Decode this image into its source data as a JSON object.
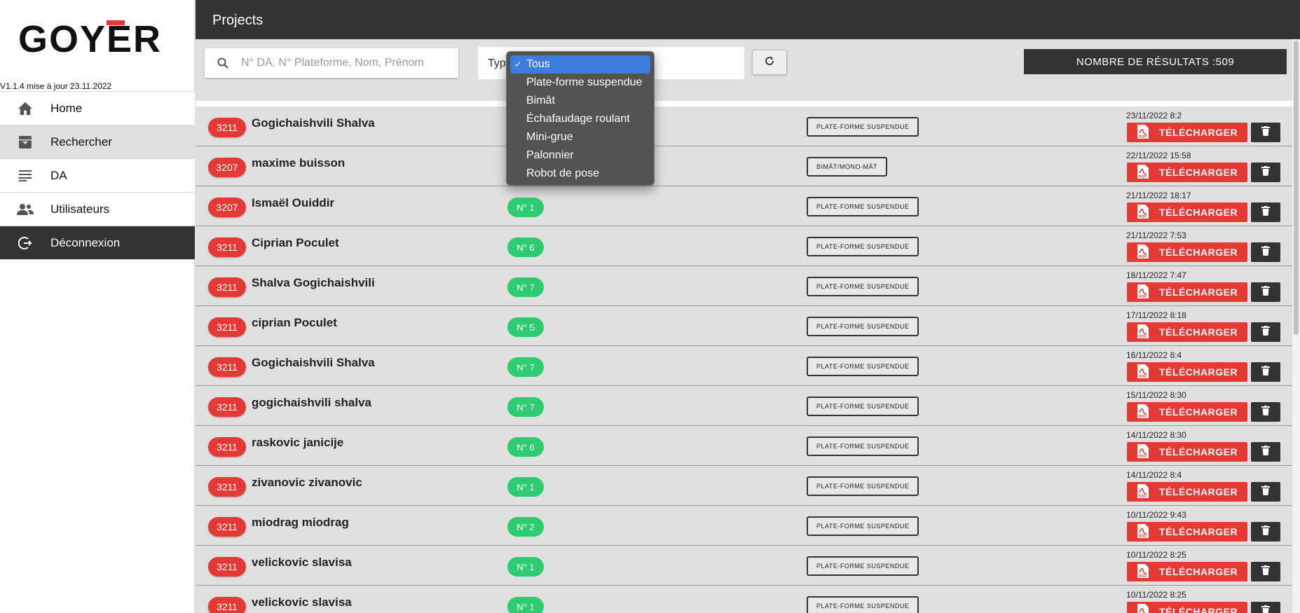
{
  "brand": {
    "logo_text": "GOYER",
    "version": "V1.1.4 mise à jour 23.11.2022",
    "accent": "#e53935"
  },
  "sidebar": {
    "items": [
      {
        "label": "Home",
        "icon": "home-icon"
      },
      {
        "label": "Rechercher",
        "icon": "archive-icon"
      },
      {
        "label": "DA",
        "icon": "lines-icon"
      },
      {
        "label": "Utilisateurs",
        "icon": "users-icon"
      },
      {
        "label": "Déconnexion",
        "icon": "logout-icon"
      }
    ]
  },
  "header": {
    "title": "Projects"
  },
  "filters": {
    "search_placeholder": "N° DA, N° Plateforme, Nom, Prénom",
    "type_label": "Type",
    "results_label": "NOMBRE DE RÉSULTATS :509"
  },
  "dropdown": {
    "check": "✓",
    "options": [
      "Tous",
      "Plate-forme suspendue",
      "Bimât",
      "Échafaudage roulant",
      "Mini-grue",
      "Palonnier",
      "Robot de pose"
    ],
    "selected": "Tous"
  },
  "row_actions": {
    "download_label": "TÉLÉCHARGER",
    "pdf_text": "PDF"
  },
  "rows": [
    {
      "da": "3211",
      "name": "Gogichaishvili Shalva",
      "num": "",
      "type": "PLATE-FORME SUSPENDUE",
      "date": "23/11/2022 8:2"
    },
    {
      "da": "3207",
      "name": "maxime buisson",
      "num": "",
      "type": "BIMÂT/MONO-MÂT",
      "date": "22/11/2022 15:58"
    },
    {
      "da": "3207",
      "name": "Ismaël Ouiddir",
      "num": "N° 1",
      "type": "PLATE-FORME SUSPENDUE",
      "date": "21/11/2022 18:17"
    },
    {
      "da": "3211",
      "name": "Ciprian Poculet",
      "num": "N° 6",
      "type": "PLATE-FORME SUSPENDUE",
      "date": "21/11/2022 7:53"
    },
    {
      "da": "3211",
      "name": "Shalva Gogichaishvili",
      "num": "N° 7",
      "type": "PLATE-FORME SUSPENDUE",
      "date": "18/11/2022 7:47"
    },
    {
      "da": "3211",
      "name": "ciprian Poculet",
      "num": "N° 5",
      "type": "PLATE-FORME SUSPENDUE",
      "date": "17/11/2022 8:18"
    },
    {
      "da": "3211",
      "name": "Gogichaishvili Shalva",
      "num": "N° 7",
      "type": "PLATE-FORME SUSPENDUE",
      "date": "16/11/2022 8:4"
    },
    {
      "da": "3211",
      "name": "gogichaishvili shalva",
      "num": "N° 7",
      "type": "PLATE-FORME SUSPENDUE",
      "date": "15/11/2022 8:30"
    },
    {
      "da": "3211",
      "name": "raskovic janicije",
      "num": "N° 6",
      "type": "PLATE-FORME SUSPENDUE",
      "date": "14/11/2022 8:30"
    },
    {
      "da": "3211",
      "name": "zivanovic zivanovic",
      "num": "N° 1",
      "type": "PLATE-FORME SUSPENDUE",
      "date": "14/11/2022 8:4"
    },
    {
      "da": "3211",
      "name": "miodrag miodrag",
      "num": "N° 2",
      "type": "PLATE-FORME SUSPENDUE",
      "date": "10/11/2022 9:43"
    },
    {
      "da": "3211",
      "name": "velickovic slavisa",
      "num": "N° 1",
      "type": "PLATE-FORME SUSPENDUE",
      "date": "10/11/2022 8:25"
    },
    {
      "da": "3211",
      "name": "velickovic slavisa",
      "num": "N° 1",
      "type": "PLATE-FORME SUSPENDUE",
      "date": "10/11/2022 8:25"
    }
  ]
}
